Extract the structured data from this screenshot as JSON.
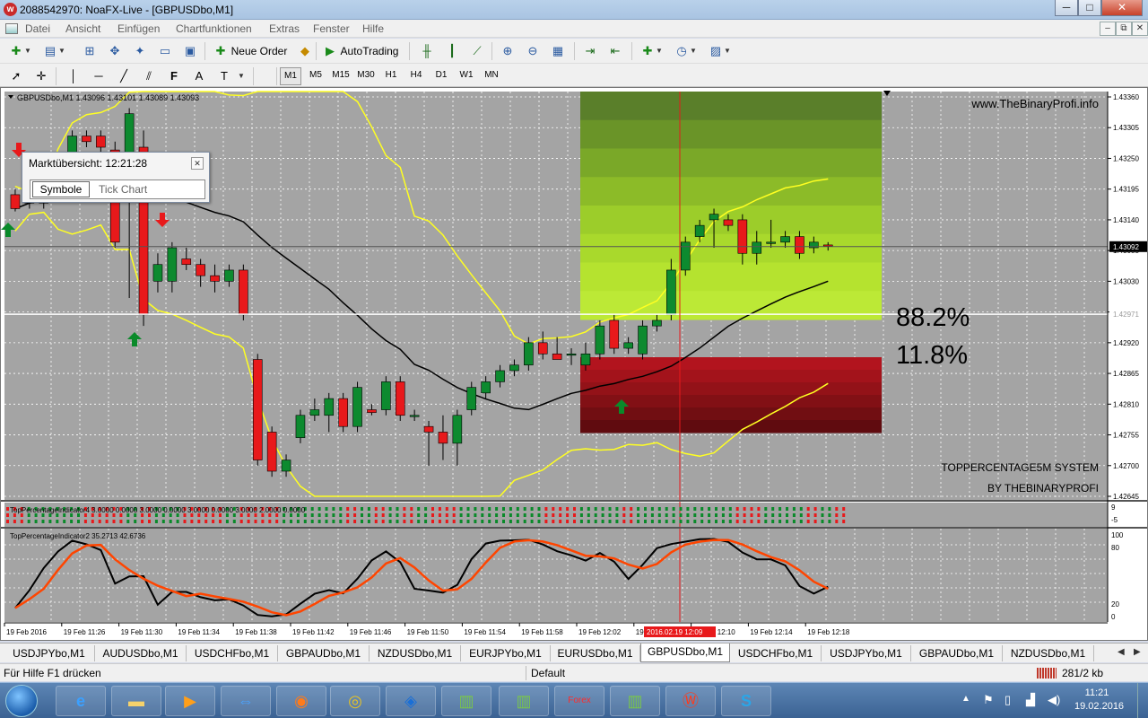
{
  "window": {
    "title": "2088542970: NoaFX-Live - [GBPUSDbo,M1]",
    "icon_symbol": "w"
  },
  "window_controls": {
    "minimize": "─",
    "maximize": "□",
    "close": "✕"
  },
  "menu": {
    "items": [
      "Datei",
      "Ansicht",
      "Einfügen",
      "Chartfunktionen",
      "Extras",
      "Fenster",
      "Hilfe"
    ],
    "mdi_controls": {
      "minimize": "–",
      "restore": "⧉",
      "close": "✕"
    }
  },
  "toolbar": {
    "new_order_label": "Neue Order",
    "autotrading_label": "AutoTrading",
    "timeframes": [
      "M1",
      "M5",
      "M15",
      "M30",
      "H1",
      "H4",
      "D1",
      "W1",
      "MN"
    ],
    "text_tool": "A"
  },
  "chart": {
    "header": "GBPUSDbo,M1  1.43096 1.43101 1.43089 1.43093",
    "watermark": "www.TheBinaryProfi.info",
    "percent_up": "88.2%",
    "percent_down": "11.8%",
    "system_line1": "TOPPERCENTAGE5M SYSTEM",
    "system_line2": "BY THEBINARYPROFI",
    "price_labels": [
      "1.43360",
      "1.43305",
      "1.43250",
      "1.43195",
      "1.43140",
      "1.43085",
      "1.43030",
      "1.42975",
      "1.42920",
      "1.42865",
      "1.42810",
      "1.42755",
      "1.42700",
      "1.42645"
    ],
    "current_price": "1.43092",
    "white_line_price": "1.42971",
    "time_labels": [
      "19 Feb 2016",
      "19 Feb 11:26",
      "19 Feb 11:30",
      "19 Feb 11:34",
      "19 Feb 11:38",
      "19 Feb 11:42",
      "19 Feb 11:46",
      "19 Feb 11:50",
      "19 Feb 11:54",
      "19 Feb 11:58",
      "19 Feb 12:02",
      "19 Feb 12:06",
      "19 Feb 12:10",
      "19 Feb 12:14",
      "19 Feb 12:18"
    ],
    "crosshair_time": "2016.02.19 12:09",
    "indicator1_label": "TopPercentageIndicator4 3.0000 0.0000 3.0000 0.0000 3.0000 0.0000 3.0000 2.0000 0.0000",
    "indicator1_scale": [
      "9",
      "-5"
    ],
    "indicator2_label": "TopPercentageIndicator2 35.2713 42.6736",
    "indicator2_scale": [
      "100",
      "80",
      "20",
      "0"
    ],
    "colors": {
      "bg": "#a4a4a4",
      "bull": "#0d8a2f",
      "bear": "#e8191b",
      "band": "#ffff22",
      "ma": "#000000",
      "osc_fast": "#000000",
      "osc_slow": "#ff4500",
      "grid": "#ffffff"
    }
  },
  "market_watch": {
    "title": "Marktübersicht: 12:21:28",
    "tab_active": "Symbole",
    "tab_other": "Tick Chart"
  },
  "symbol_tabs": [
    "USDJPYbo,M1",
    "AUDUSDbo,M1",
    "USDCHFbo,M1",
    "GBPAUDbo,M1",
    "NZDUSDbo,M1",
    "EURJPYbo,M1",
    "EURUSDbo,M1",
    "GBPUSDbo,M1",
    "USDCHFbo,M1",
    "USDJPYbo,M1",
    "GBPAUDbo,M1",
    "NZDUSDbo,M1"
  ],
  "active_tab_index": 7,
  "status": {
    "help": "Für Hilfe F1 drücken",
    "profile": "Default",
    "traffic": "281/2 kb"
  },
  "taskbar": {
    "time": "11:21",
    "date": "19.02.2016"
  },
  "chart_data": {
    "type": "candlestick",
    "symbol": "GBPUSDbo",
    "timeframe": "M1",
    "ylim": [
      1.42645,
      1.4336
    ],
    "candles": [
      {
        "o": 1.43185,
        "h": 1.43195,
        "l": 1.43155,
        "c": 1.4316
      },
      {
        "o": 1.4317,
        "h": 1.432,
        "l": 1.4316,
        "c": 1.4318
      },
      {
        "o": 1.4317,
        "h": 1.4319,
        "l": 1.4316,
        "c": 1.43185
      },
      {
        "o": 1.43185,
        "h": 1.4326,
        "l": 1.43175,
        "c": 1.43255
      },
      {
        "o": 1.4326,
        "h": 1.433,
        "l": 1.4325,
        "c": 1.4329
      },
      {
        "o": 1.4329,
        "h": 1.433,
        "l": 1.4327,
        "c": 1.4328
      },
      {
        "o": 1.4329,
        "h": 1.433,
        "l": 1.4326,
        "c": 1.4327
      },
      {
        "o": 1.43265,
        "h": 1.4328,
        "l": 1.4309,
        "c": 1.431
      },
      {
        "o": 1.4324,
        "h": 1.4334,
        "l": 1.43,
        "c": 1.4333
      },
      {
        "o": 1.4327,
        "h": 1.433,
        "l": 1.4295,
        "c": 1.4297
      },
      {
        "o": 1.4303,
        "h": 1.4308,
        "l": 1.4301,
        "c": 1.4306
      },
      {
        "o": 1.4303,
        "h": 1.431,
        "l": 1.4301,
        "c": 1.4309
      },
      {
        "o": 1.4307,
        "h": 1.4309,
        "l": 1.4305,
        "c": 1.4306
      },
      {
        "o": 1.4306,
        "h": 1.4307,
        "l": 1.4302,
        "c": 1.4304
      },
      {
        "o": 1.4304,
        "h": 1.4306,
        "l": 1.4301,
        "c": 1.4303
      },
      {
        "o": 1.4303,
        "h": 1.4306,
        "l": 1.4302,
        "c": 1.4305
      },
      {
        "o": 1.4305,
        "h": 1.4306,
        "l": 1.4296,
        "c": 1.4297
      },
      {
        "o": 1.4289,
        "h": 1.429,
        "l": 1.427,
        "c": 1.4271
      },
      {
        "o": 1.4276,
        "h": 1.4277,
        "l": 1.4268,
        "c": 1.4269
      },
      {
        "o": 1.4269,
        "h": 1.4272,
        "l": 1.4268,
        "c": 1.4271
      },
      {
        "o": 1.4275,
        "h": 1.428,
        "l": 1.4274,
        "c": 1.4279
      },
      {
        "o": 1.4279,
        "h": 1.4282,
        "l": 1.4278,
        "c": 1.428
      },
      {
        "o": 1.4279,
        "h": 1.4283,
        "l": 1.4276,
        "c": 1.4282
      },
      {
        "o": 1.4282,
        "h": 1.4283,
        "l": 1.4276,
        "c": 1.4277
      },
      {
        "o": 1.4277,
        "h": 1.4285,
        "l": 1.4276,
        "c": 1.4284
      },
      {
        "o": 1.428,
        "h": 1.4281,
        "l": 1.4279,
        "c": 1.42795
      },
      {
        "o": 1.428,
        "h": 1.4286,
        "l": 1.4279,
        "c": 1.4285
      },
      {
        "o": 1.4285,
        "h": 1.4286,
        "l": 1.4278,
        "c": 1.4279
      },
      {
        "o": 1.4279,
        "h": 1.428,
        "l": 1.4278,
        "c": 1.4279
      },
      {
        "o": 1.4277,
        "h": 1.4278,
        "l": 1.427,
        "c": 1.4276
      },
      {
        "o": 1.4276,
        "h": 1.4279,
        "l": 1.4271,
        "c": 1.4274
      },
      {
        "o": 1.4274,
        "h": 1.428,
        "l": 1.427,
        "c": 1.4279
      },
      {
        "o": 1.428,
        "h": 1.4285,
        "l": 1.4279,
        "c": 1.4284
      },
      {
        "o": 1.4283,
        "h": 1.4286,
        "l": 1.4282,
        "c": 1.4285
      },
      {
        "o": 1.4285,
        "h": 1.4288,
        "l": 1.4284,
        "c": 1.4287
      },
      {
        "o": 1.4287,
        "h": 1.4289,
        "l": 1.4286,
        "c": 1.4288
      },
      {
        "o": 1.4288,
        "h": 1.4293,
        "l": 1.4287,
        "c": 1.4292
      },
      {
        "o": 1.4292,
        "h": 1.4294,
        "l": 1.4289,
        "c": 1.429
      },
      {
        "o": 1.429,
        "h": 1.4293,
        "l": 1.4289,
        "c": 1.4289
      },
      {
        "o": 1.429,
        "h": 1.4291,
        "l": 1.4288,
        "c": 1.429
      },
      {
        "o": 1.4288,
        "h": 1.4292,
        "l": 1.4287,
        "c": 1.429
      },
      {
        "o": 1.429,
        "h": 1.4296,
        "l": 1.4289,
        "c": 1.4295
      },
      {
        "o": 1.4296,
        "h": 1.4297,
        "l": 1.429,
        "c": 1.4291
      },
      {
        "o": 1.4291,
        "h": 1.4293,
        "l": 1.429,
        "c": 1.4292
      },
      {
        "o": 1.429,
        "h": 1.4296,
        "l": 1.4289,
        "c": 1.4295
      },
      {
        "o": 1.4295,
        "h": 1.4297,
        "l": 1.4294,
        "c": 1.4296
      },
      {
        "o": 1.4297,
        "h": 1.4307,
        "l": 1.4296,
        "c": 1.4305
      },
      {
        "o": 1.4305,
        "h": 1.4311,
        "l": 1.4304,
        "c": 1.431
      },
      {
        "o": 1.4311,
        "h": 1.4314,
        "l": 1.431,
        "c": 1.4313
      },
      {
        "o": 1.4314,
        "h": 1.4316,
        "l": 1.4309,
        "c": 1.4315
      },
      {
        "o": 1.4314,
        "h": 1.4315,
        "l": 1.4312,
        "c": 1.4313
      },
      {
        "o": 1.4314,
        "h": 1.4315,
        "l": 1.4306,
        "c": 1.4308
      },
      {
        "o": 1.4308,
        "h": 1.4312,
        "l": 1.4306,
        "c": 1.431
      },
      {
        "o": 1.431,
        "h": 1.4314,
        "l": 1.4309,
        "c": 1.431
      },
      {
        "o": 1.431,
        "h": 1.4312,
        "l": 1.4309,
        "c": 1.4311
      },
      {
        "o": 1.4311,
        "h": 1.4312,
        "l": 1.4307,
        "c": 1.4308
      },
      {
        "o": 1.4309,
        "h": 1.4311,
        "l": 1.4308,
        "c": 1.431
      },
      {
        "o": 1.43095,
        "h": 1.431,
        "l": 1.43085,
        "c": 1.43093
      }
    ]
  }
}
